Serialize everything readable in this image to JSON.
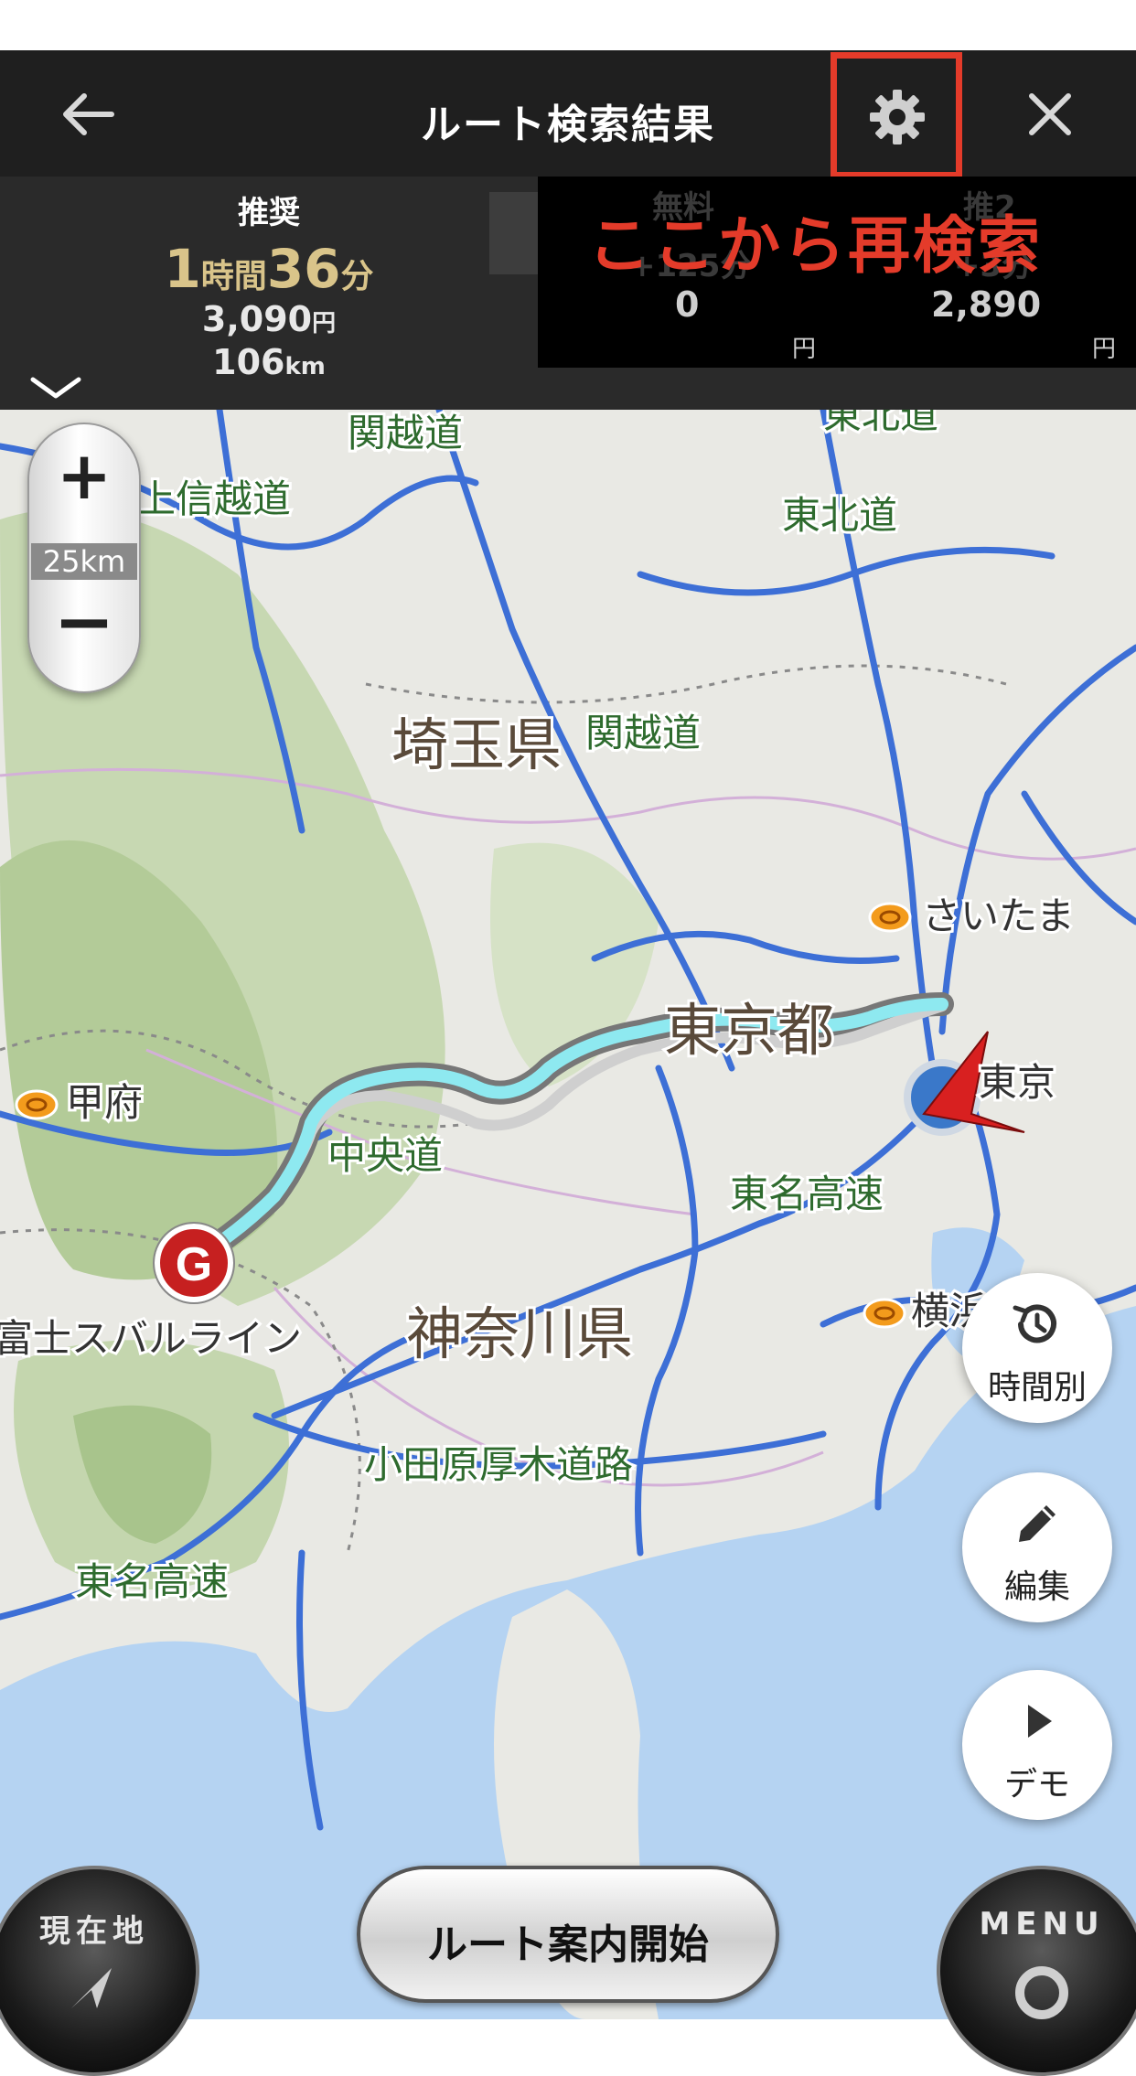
{
  "header": {
    "title": "ルート検索結果"
  },
  "routes": {
    "recommended": {
      "label": "推奨",
      "hours": "1",
      "hours_unit": "時間",
      "minutes": "36",
      "minutes_unit": "分",
      "price": "3,090",
      "price_unit": "円",
      "distance": "106",
      "distance_unit": "km"
    },
    "free": {
      "label": "無料",
      "time_diff": "+125分",
      "price": "0",
      "price_unit": "円"
    },
    "second": {
      "label": "推2",
      "time_diff": "+3分",
      "price": "2,890",
      "price_unit": "円"
    }
  },
  "overlay": {
    "annotation": "ここから再検索"
  },
  "zoom": {
    "plus": "+",
    "minus": "−",
    "scale": "25km"
  },
  "map": {
    "labels": {
      "kanetsu1": "関越道",
      "kanetsu2": "関越道",
      "joshinetsu": "上信越道",
      "tohoku1": "東北道",
      "tohoku2": "東北道",
      "saitama_pref": "埼玉県",
      "saitama_city": "さいたま",
      "tokyo_pref": "東京都",
      "tokyo_city": "東京",
      "kofu": "甲府",
      "chuo": "中央道",
      "tomei1": "東名高速",
      "tomei2": "東名高速",
      "yokohama": "横浜",
      "kanagawa": "神奈川県",
      "odawara": "小田原厚木道路",
      "fuji_subaru": "富士スバルライン",
      "goal_marker": "G"
    }
  },
  "side_buttons": {
    "by_time": "時間別",
    "edit": "編集",
    "demo": "デモ"
  },
  "bottom": {
    "start": "ルート案内開始",
    "current_location": "現在地",
    "menu": "MENU"
  },
  "colors": {
    "header_bg": "#1f1f1f",
    "accent_red": "#e43b2a",
    "route": "#8ee9f0",
    "road": "#3d6fd6",
    "land": "#e9e9e4",
    "sea": "#b5d3f2",
    "forest": "#b8cfa0"
  }
}
